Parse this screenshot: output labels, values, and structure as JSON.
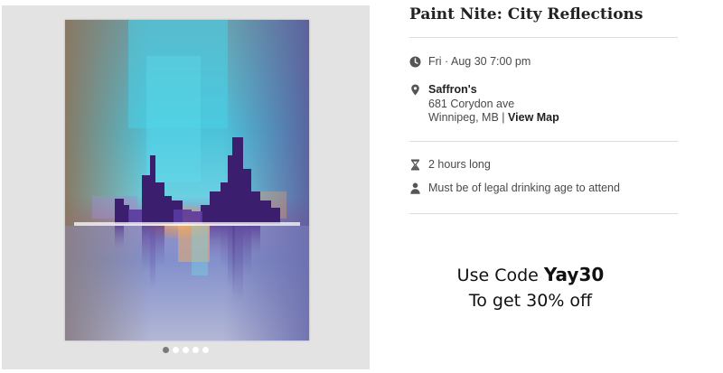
{
  "event": {
    "title": "Paint Nite: City Reflections",
    "datetime": "Fri · Aug 30 7:00 pm",
    "venue": {
      "name": "Saffron's",
      "address": "681 Corydon ave",
      "city": "Winnipeg, MB",
      "separator": "|",
      "map_link": "View Map"
    },
    "duration": "2 hours long",
    "age_note": "Must be of legal drinking age to attend"
  },
  "promo": {
    "prefix": "Use Code",
    "code": "Yay30",
    "line2": "To get 30% off"
  },
  "gallery": {
    "slide_count": 5,
    "active_slide": 1
  },
  "icons": {
    "datetime": "clock-icon",
    "venue": "map-pin-icon",
    "duration": "hourglass-icon",
    "age_note": "person-icon"
  },
  "colors": {
    "icon": "#555555",
    "active_dot": "#7a7a7a",
    "rule": "#dcdcdc",
    "gallery_bg": "#e3e3e3"
  }
}
